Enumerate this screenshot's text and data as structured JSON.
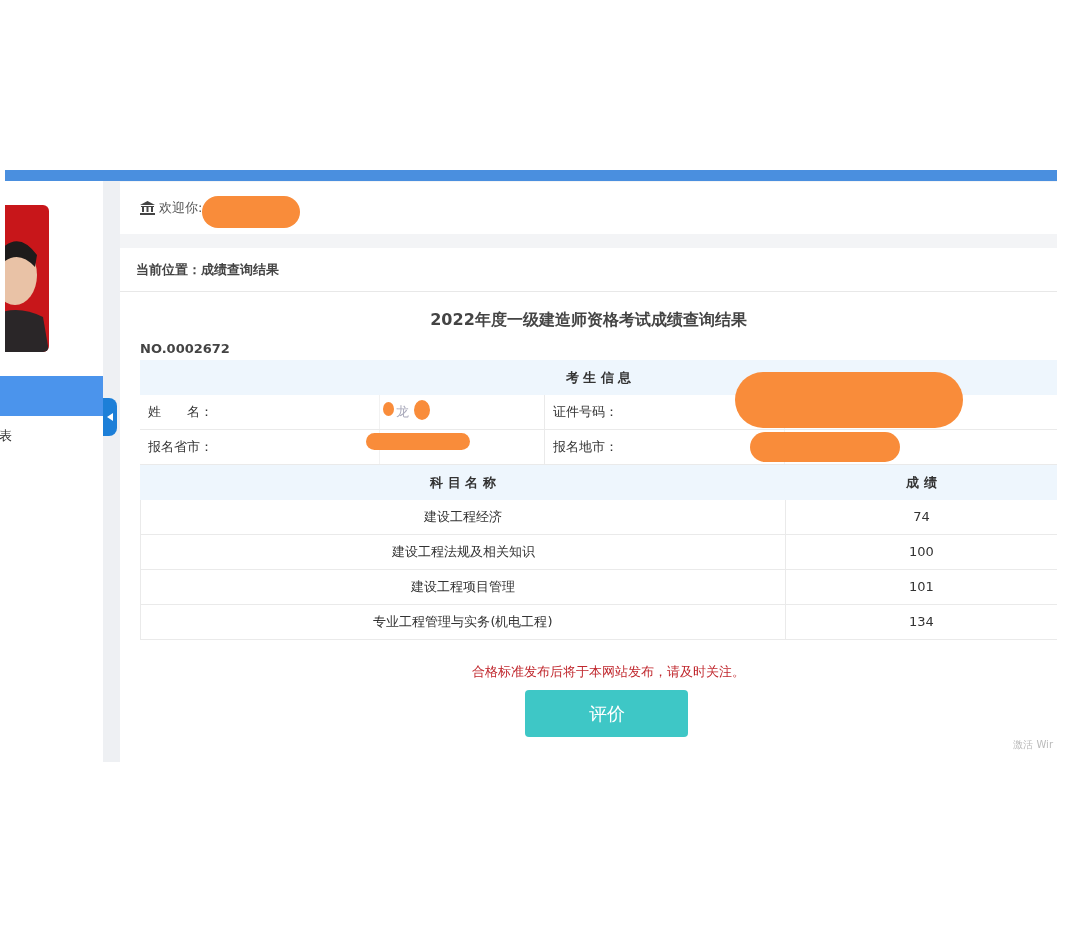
{
  "sidebar": {
    "items": [
      {
        "selected": true
      },
      {
        "label": "表",
        "selected": false
      }
    ]
  },
  "welcome": {
    "label": "欢迎你:"
  },
  "breadcrumb": "当前位置：成绩查询结果",
  "title": "2022年度一级建造师资格考试成绩查询结果",
  "number": "NO.0002672",
  "info": {
    "heading": "考 生 信 息",
    "rows": [
      [
        {
          "label": "姓　　名：",
          "value": "龙"
        },
        {
          "label": "证件号码："
        }
      ],
      [
        {
          "label": "报名省市："
        },
        {
          "label": "报名地市："
        }
      ]
    ]
  },
  "scores": {
    "columns": [
      "科 目 名 称",
      "成 绩"
    ],
    "rows": [
      {
        "subject": "建设工程经济",
        "score": "74"
      },
      {
        "subject": "建设工程法规及相关知识",
        "score": "100"
      },
      {
        "subject": "建设工程项目管理",
        "score": "101"
      },
      {
        "subject": "专业工程管理与实务(机电工程)",
        "score": "134"
      }
    ]
  },
  "notice": "合格标准发布后将于本网站发布，请及时关注。",
  "button": "评价",
  "activation_text": "激活 Wir"
}
